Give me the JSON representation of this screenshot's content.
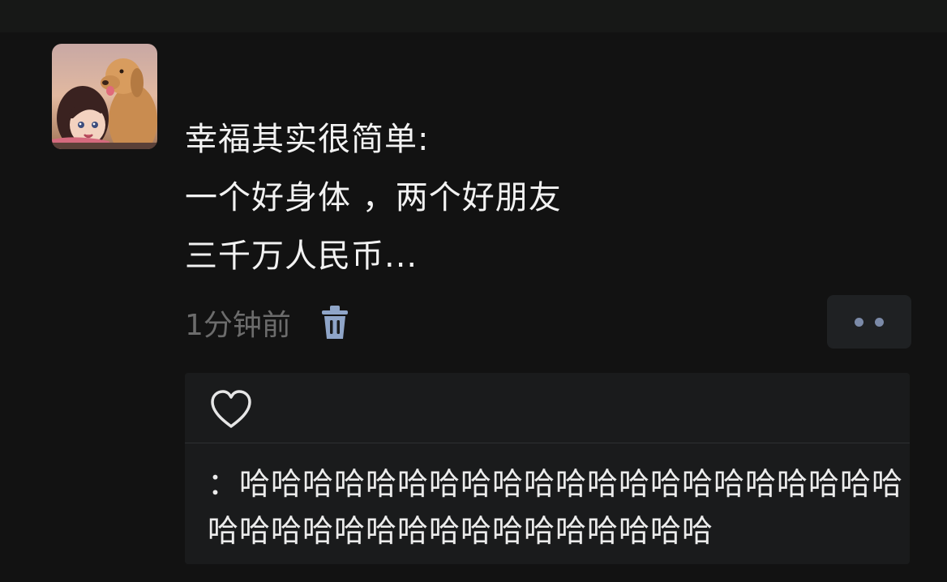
{
  "post": {
    "lines": [
      "幸福其实很简单:",
      "一个好身体 ，两个好朋友",
      "三千万人民币..."
    ],
    "timestamp": "1分钟前"
  },
  "icons": {
    "avatar": "girl-with-dog-avatar",
    "delete": "trash-icon",
    "more": "more-dots-icon",
    "like": "heart-icon"
  },
  "comment": {
    "text": "：哈哈哈哈哈哈哈哈哈哈哈哈哈哈哈哈哈哈哈哈哈哈哈哈哈哈哈哈哈哈哈哈哈哈哈哈哈"
  },
  "colors": {
    "background": "#121212",
    "panel": "#1a1b1c",
    "timestamp": "#6c6c6c",
    "accent_dots": "#7b8aa8"
  }
}
